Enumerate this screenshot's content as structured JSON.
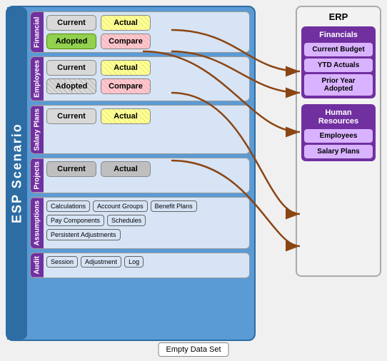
{
  "app": {
    "title": "ESP Scenario"
  },
  "sections": {
    "financial": {
      "label": "Financial",
      "row1": {
        "btn1": "Current",
        "btn2": "Actual"
      },
      "row2": {
        "btn1": "Adopted",
        "btn2": "Compare"
      }
    },
    "employees": {
      "label": "Employees",
      "row1": {
        "btn1": "Current",
        "btn2": "Actual"
      },
      "row2": {
        "btn1": "Adopted",
        "btn2": "Compare"
      }
    },
    "salary": {
      "label": "Salary Plans",
      "row1": {
        "btn1": "Current",
        "btn2": "Actual"
      }
    },
    "projects": {
      "label": "Projects",
      "row1": {
        "btn1": "Current",
        "btn2": "Actual"
      }
    },
    "assumptions": {
      "label": "Assumptions",
      "btns": [
        "Calculations",
        "Account Groups",
        "Benefit Plans",
        "Pay Components",
        "Schedules",
        "Persistent Adjustments"
      ]
    },
    "audit": {
      "label": "Audit",
      "btns": [
        "Session",
        "Adjustment",
        "Log"
      ]
    }
  },
  "erp": {
    "title": "ERP",
    "financials_group": {
      "label": "Financials",
      "items": [
        "Current Budget",
        "YTD Actuals",
        "Prior Year Adopted"
      ]
    },
    "hr_group": {
      "label": "Human Resources",
      "items": [
        "Employees",
        "Salary Plans"
      ]
    }
  },
  "empty_dataset": "Empty Data Set"
}
